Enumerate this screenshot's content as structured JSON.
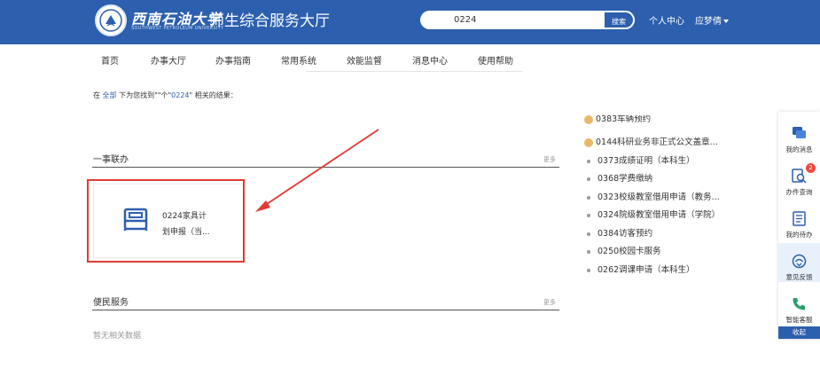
{
  "header": {
    "logo_cn": "西南石油大学",
    "logo_en": "SOUTHWEST PETROLEUM UNIVERSITY",
    "site_title": "师生综合服务大厅",
    "search_value": "0224",
    "search_button": "搜索",
    "personal_center": "个人中心",
    "user_name": "应梦倩"
  },
  "nav": {
    "items": [
      "首页",
      "办事大厅",
      "办事指南",
      "常用系统",
      "效能监督",
      "消息中心",
      "使用帮助"
    ]
  },
  "result": {
    "prefix": "在",
    "scope": "全部",
    "middle": "下为您找到\"",
    "count": "\"个\"",
    "keyword": "0224",
    "suffix": "\" 相关的结果："
  },
  "section1": {
    "title": "一事联办",
    "more": "更多",
    "card": {
      "icon": "bed-icon",
      "line1": "0224家具计",
      "line2": "划申报（当..."
    }
  },
  "section2": {
    "title": "便民服务",
    "more": "更多",
    "empty": "暂无相关数据"
  },
  "right_list": {
    "items": [
      "0383车辆预约",
      "0144科研业务非正式公文盖章...",
      "0373成绩证明（本科生）",
      "0368学费缴纳",
      "0323校级教室借用申请（教务...",
      "0324院级教室借用申请（学院）",
      "0384访客预约",
      "0250校园卡服务",
      "0262调课申请（本科生）"
    ]
  },
  "sidebar": {
    "items": [
      {
        "label": "我的消息",
        "icon": "message-icon"
      },
      {
        "label": "办件查询",
        "icon": "search-doc-icon",
        "badge": "2"
      },
      {
        "label": "我的待办",
        "icon": "todo-icon"
      },
      {
        "label": "意见反馈",
        "icon": "feedback-icon"
      },
      {
        "label": "智能客服",
        "icon": "phone-icon"
      }
    ],
    "collapse": "收起"
  },
  "colors": {
    "brand": "#2c5fae",
    "highlight": "#e23a33"
  }
}
